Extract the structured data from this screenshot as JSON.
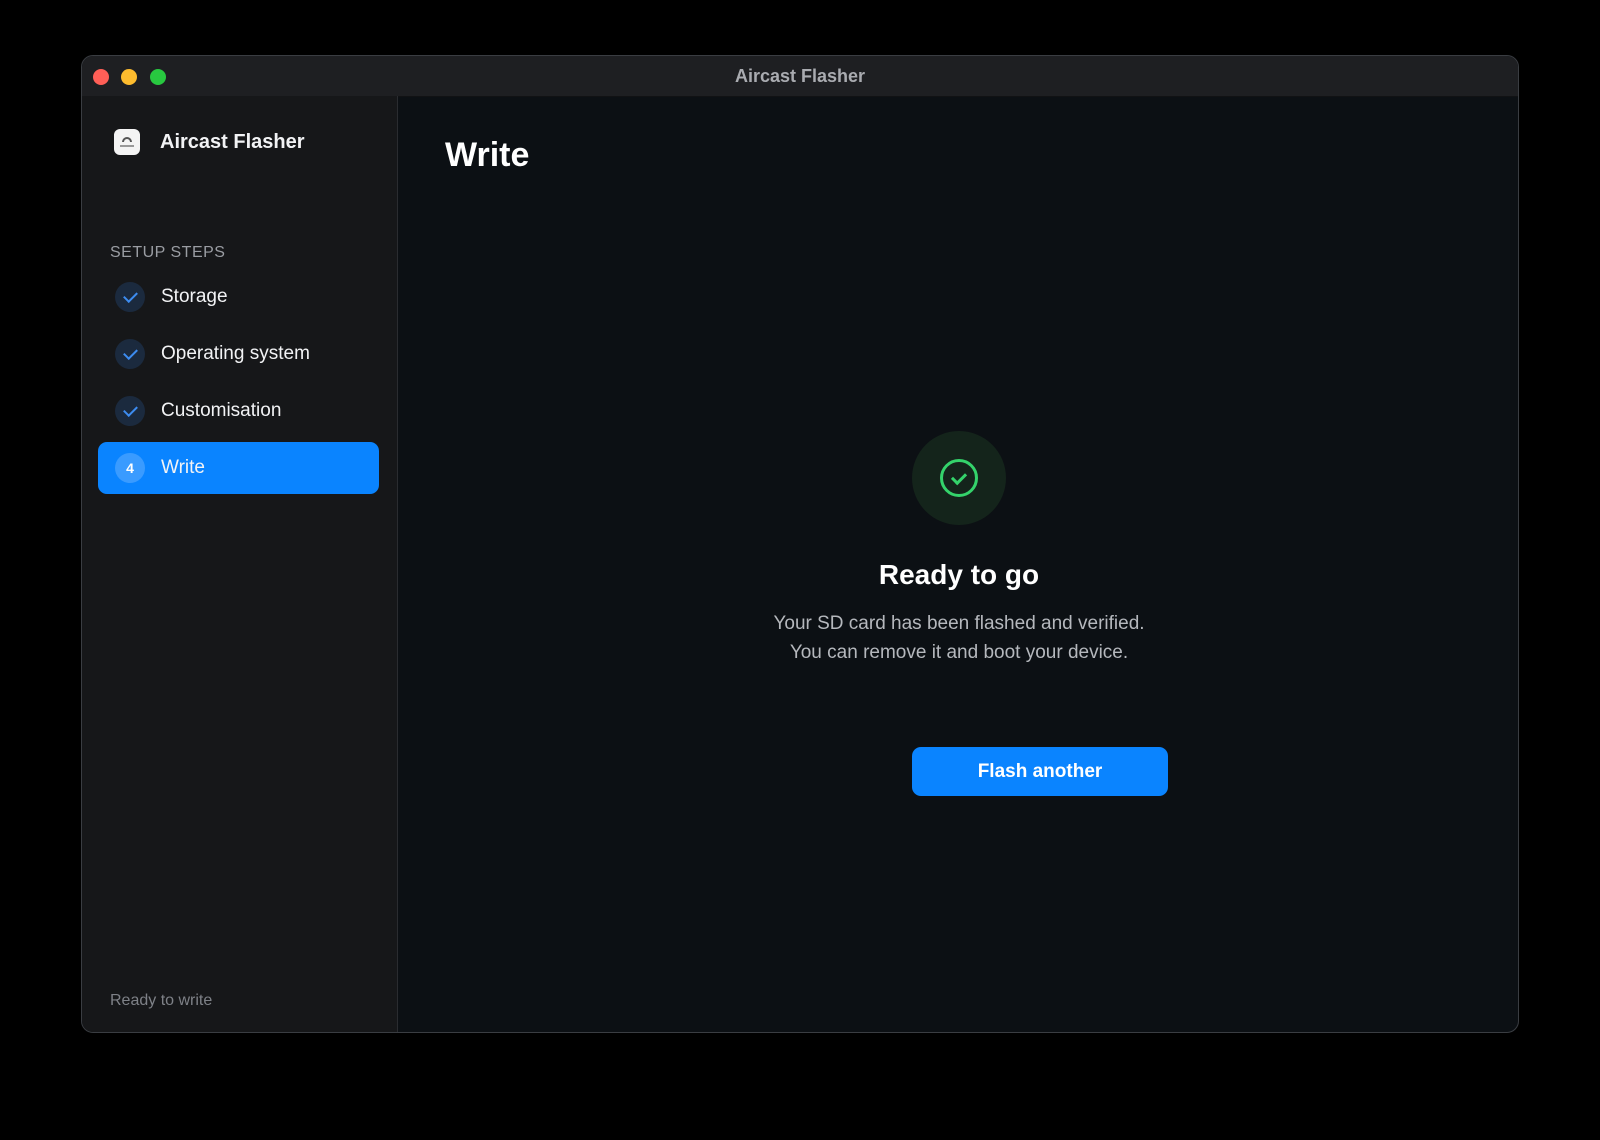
{
  "window": {
    "title": "Aircast Flasher"
  },
  "sidebar": {
    "app_name": "Aircast Flasher",
    "section_label": "SETUP STEPS",
    "steps": [
      {
        "label": "Storage",
        "state": "completed",
        "icon": "check-icon"
      },
      {
        "label": "Operating system",
        "state": "completed",
        "icon": "check-icon"
      },
      {
        "label": "Customisation",
        "state": "completed",
        "icon": "check-icon"
      },
      {
        "label": "Write",
        "state": "active",
        "number": "4"
      }
    ],
    "status": "Ready to write"
  },
  "main": {
    "title": "Write",
    "result": {
      "icon": "check-circle-icon",
      "title": "Ready to go",
      "line1": "Your SD card has been flashed and verified.",
      "line2": "You can remove it and boot your device."
    },
    "action_label": "Flash another"
  },
  "colors": {
    "accent": "#0a84ff",
    "success": "#34d36b",
    "window_bg": "#0c1014",
    "sidebar_bg": "#161719"
  }
}
